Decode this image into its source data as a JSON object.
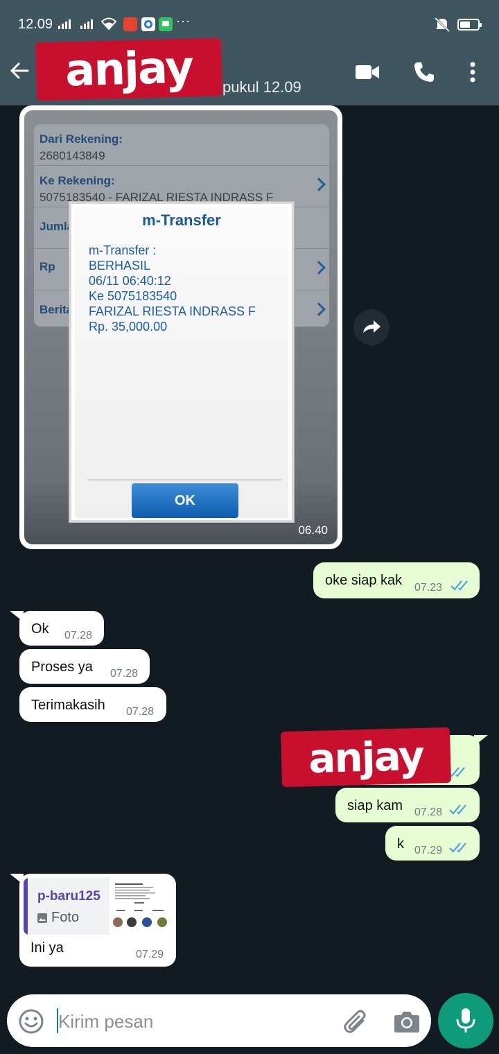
{
  "status_bar": {
    "time": "12.09",
    "more": "···"
  },
  "header": {
    "watermark": "anjay",
    "subtitle": "i pukul 12.09"
  },
  "image_message": {
    "form": {
      "from_label": "Dari Rekening:",
      "from_value": "2680143849",
      "to_label": "Ke Rekening:",
      "to_value": "5075183540 - FARIZAL RIESTA INDRASS F",
      "amount_label": "Jumla",
      "rp_label": "Rp",
      "news_label": "Berita"
    },
    "dialog": {
      "title": "m-Transfer",
      "lines": [
        "m-Transfer :",
        "BERHASIL",
        "06/11 06:40:12",
        "Ke 5075183540",
        "FARIZAL RIESTA INDRASS F",
        "Rp. 35,000.00"
      ],
      "ok": "OK"
    },
    "time": "06.40"
  },
  "messages": [
    {
      "dir": "out",
      "text": "oke siap kak",
      "time": "07.23"
    },
    {
      "dir": "in",
      "text": "Ok",
      "time": "07.28"
    },
    {
      "dir": "in",
      "text": "Proses ya",
      "time": "07.28"
    },
    {
      "dir": "in",
      "text": "Terimakasih",
      "time": "07.28"
    },
    {
      "dir": "out",
      "text": "siap kam",
      "time": "07.28"
    },
    {
      "dir": "out",
      "text": "k",
      "time": "07.29"
    }
  ],
  "sticker_message": {
    "watermark": "anjay"
  },
  "reply_message": {
    "quote_name": "p-baru125",
    "quote_media": "Foto",
    "text": "Ini ya",
    "time": "07.29"
  },
  "input": {
    "placeholder": "Kirim pesan"
  },
  "colors": {
    "header": "#3f5661",
    "background": "#121b22",
    "outgoing": "#e6fcd3",
    "incoming": "#ffffff",
    "accent": "#0e9b7a",
    "ticks": "#4fa3e0"
  }
}
